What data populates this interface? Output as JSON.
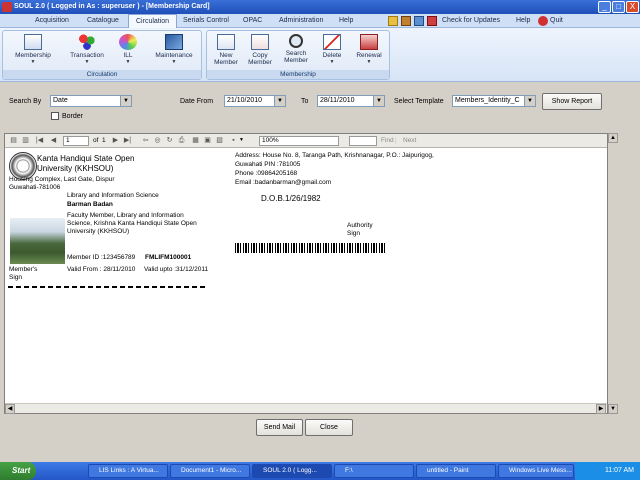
{
  "window": {
    "title": "SOUL 2.0  ( Logged in As : superuser ) - [Membership Card]",
    "minimize": "_",
    "maximize": "□",
    "close": "X"
  },
  "menu": {
    "tabs": [
      "Acquisition",
      "Catalogue",
      "Circulation",
      "Serials Control",
      "OPAC",
      "Administration",
      "Help"
    ],
    "active_tab": "Circulation",
    "check_updates": "Check for Updates",
    "help": "Help",
    "quit": "Quit"
  },
  "ribbon": {
    "circulation_group": "Circulation",
    "membership_group": "Membership",
    "buttons": {
      "membership": "Membership",
      "transaction": "Transaction",
      "ill": "ILL",
      "maintenance": "Maintenance",
      "new_member_1": "New",
      "new_member_2": "Member",
      "copy_member_1": "Copy",
      "copy_member_2": "Member",
      "search_member_1": "Search",
      "search_member_2": "Member",
      "delete": "Delete",
      "renewal": "Renewal"
    }
  },
  "filters": {
    "search_by_label": "Search By",
    "search_by_value": "Date",
    "border_label": "Border",
    "date_from_label": "Date From",
    "date_from": "21/10/2010",
    "to_label": "To",
    "date_to": "28/11/2010",
    "template_label": "Select Template",
    "template_value": "Members_Identity_C",
    "show_report": "Show Report"
  },
  "viewer": {
    "page_current": "1",
    "page_of": "of",
    "page_total": "1",
    "zoom": "100%",
    "find": "Find",
    "next": "Next"
  },
  "card": {
    "uni_line1": "Kanta Handiqui State Open",
    "uni_line2": "University (KKHSOU)",
    "uni_addr1": "Housing Complex, Last Gate, Dispur",
    "uni_addr2": "Guwahati-781006",
    "dept": "Library and Information Science",
    "member_name": "Barman Badan",
    "designation1": "Faculty Member, Library and Information",
    "designation2": "Science, Krishna Kanta Handiqui State Open",
    "designation3": "University (KKHSOU)",
    "member_id": "Member ID :123456789",
    "member_code": "FMLIFM100001",
    "valid_from": "Valid From : 28/11/2010",
    "valid_upto": "Valid upto :31/12/2011",
    "member_sign1": "Member's",
    "member_sign2": "Sign",
    "address1": "Address: House No. 8, Taranga Path, Krishnanagar, P.O.: Jaipurigog,",
    "address2": "Guwahati PIN :781005",
    "phone": "Phone :09864205168",
    "email": "Email :badanbarman@gmail.com",
    "dob": "D.O.B.1/26/1982",
    "authority1": "Authority",
    "authority2": "Sign"
  },
  "actions": {
    "send_mail": "Send Mail",
    "close": "Close"
  },
  "taskbar": {
    "start": "Start",
    "tasks": [
      "LIS Links : A Virtua...",
      "Document1 - Micro...",
      "SOUL 2.0  ( Logg...",
      "F:\\",
      "untitled - Paint",
      "Windows Live Mess..."
    ],
    "active_task": "SOUL 2.0  ( Logg...",
    "clock": "11:07 AM"
  }
}
